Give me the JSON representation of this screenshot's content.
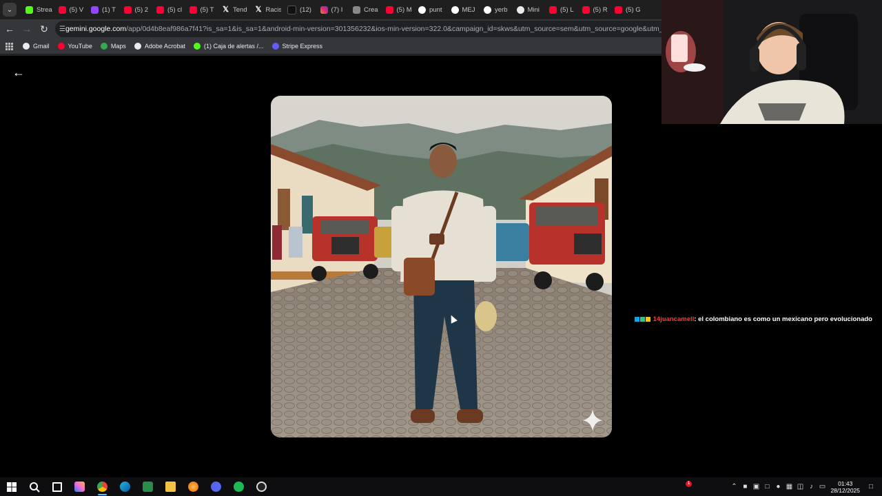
{
  "browser": {
    "tabs": [
      {
        "label": "Strea",
        "icon": "kick-icon"
      },
      {
        "label": "(5) V",
        "icon": "youtube-icon"
      },
      {
        "label": "(1) T",
        "icon": "twitch-icon"
      },
      {
        "label": "(5) 2",
        "icon": "youtube-icon"
      },
      {
        "label": "(5) cl",
        "icon": "youtube-icon"
      },
      {
        "label": "(5) T",
        "icon": "youtube-icon"
      },
      {
        "label": "Tend",
        "icon": "x-icon"
      },
      {
        "label": "Racis",
        "icon": "x-icon"
      },
      {
        "label": "(12)",
        "icon": "tiktok-icon"
      },
      {
        "label": "(7) I",
        "icon": "instagram-icon"
      },
      {
        "label": "Crea",
        "icon": "doc-icon"
      },
      {
        "label": "(5) M",
        "icon": "youtube-icon"
      },
      {
        "label": "punt",
        "icon": "google-icon"
      },
      {
        "label": "MEJ",
        "icon": "google-icon"
      },
      {
        "label": "yerb",
        "icon": "google-icon"
      },
      {
        "label": "Mini",
        "icon": "openai-icon"
      },
      {
        "label": "(5) L",
        "icon": "youtube-icon"
      },
      {
        "label": "(5) R",
        "icon": "youtube-icon"
      },
      {
        "label": "(5) G",
        "icon": "youtube-icon"
      }
    ],
    "url_host": "gemini.google.com",
    "url_rest": "/app/0d4b8eaf986a7f41?is_sa=1&is_sa=1&android-min-version=301356232&ios-min-version=322.0&campaign_id=skws&utm_source=sem&utm_source=google&utm_medium=paid-med",
    "bookmarks": [
      {
        "label": "Gmail",
        "color": "#e8eaed"
      },
      {
        "label": "YouTube",
        "color": "#ff0033"
      },
      {
        "label": "Maps",
        "color": "#34a853"
      },
      {
        "label": "Adobe Acrobat",
        "color": "#e8eaed"
      },
      {
        "label": "(1) Caja de alertas /...",
        "color": "#53fc18"
      },
      {
        "label": "Stripe Express",
        "color": "#635bff"
      }
    ]
  },
  "chat": {
    "username": "14juancamell",
    "message": ": el colombiano es como un mexicano pero evolucionado"
  },
  "taskbar": {
    "time": "01:43",
    "date": "28/12/2025",
    "notification_count": "1"
  },
  "colors": {
    "chrome_bg": "#202124",
    "toolbar_bg": "#35363a",
    "chat_username": "#ff3a3a",
    "taskbar_bg": "#0e0e10"
  }
}
